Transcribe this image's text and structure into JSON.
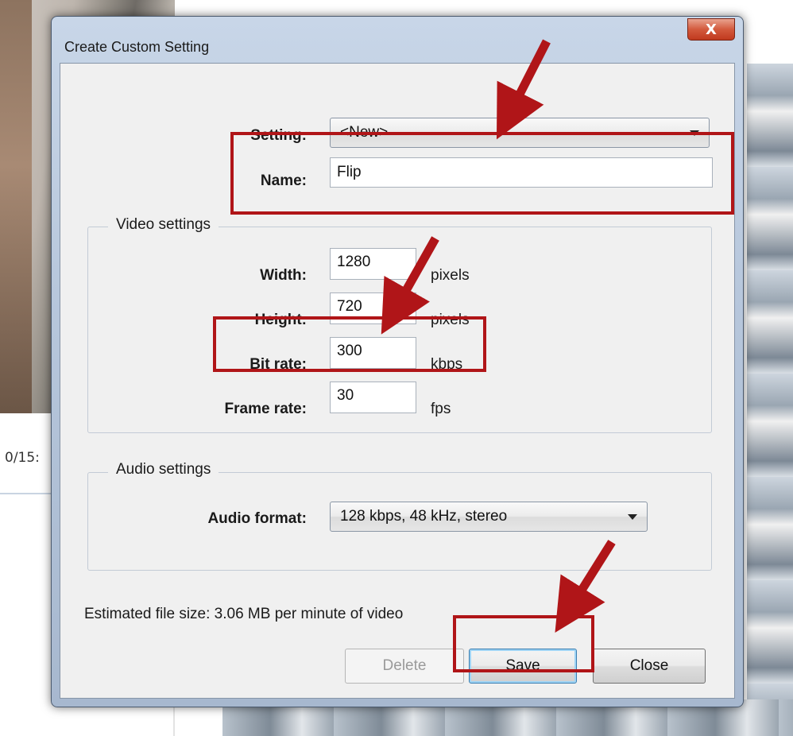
{
  "background": {
    "timecode": "0/15:"
  },
  "dialog": {
    "title": "Create Custom Setting",
    "close_glyph": "X",
    "setting": {
      "label": "Setting:",
      "value": "<New>"
    },
    "name": {
      "label": "Name:",
      "value": "Flip"
    },
    "video_group": {
      "title": "Video settings",
      "width": {
        "label": "Width:",
        "value": "1280",
        "unit": "pixels"
      },
      "height": {
        "label": "Height:",
        "value": "720",
        "unit": "pixels"
      },
      "bit_rate": {
        "label": "Bit rate:",
        "value": "300",
        "unit": "kbps"
      },
      "frame_rate": {
        "label": "Frame rate:",
        "value": "30",
        "unit": "fps"
      }
    },
    "audio_group": {
      "title": "Audio settings",
      "format": {
        "label": "Audio format:",
        "value": "128 kbps, 48 kHz, stereo"
      }
    },
    "estimate": "Estimated file size: 3.06 MB per minute of video",
    "buttons": {
      "delete": "Delete",
      "save": "Save",
      "close": "Close"
    }
  },
  "annotation_color": "#b01518"
}
